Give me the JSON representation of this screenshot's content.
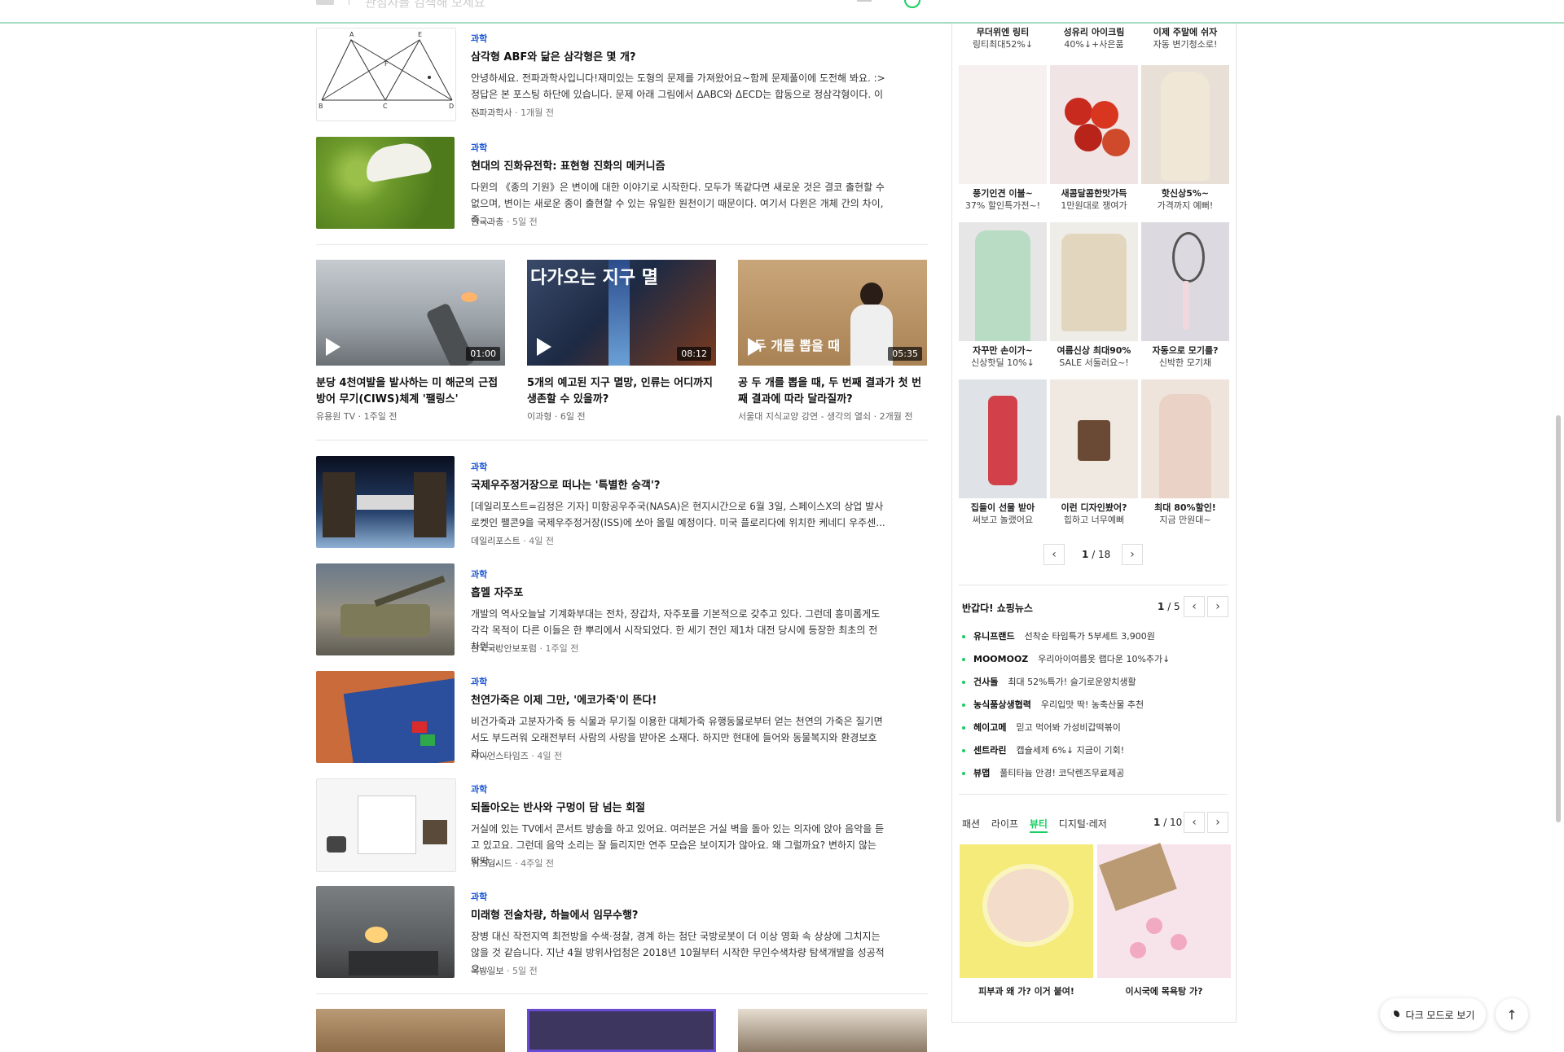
{
  "header": {
    "search_hint": "관심사를 검색해 보세요"
  },
  "articles_top": [
    {
      "category": "과학",
      "title": "삼각형 ABF와 닮은 삼각형은 몇 개?",
      "desc": "안녕하세요. 전파과학사입니다!재미있는 도형의 문제를 가져왔어요~함께 문제풀이에 도전해 봐요. :> 정답은 본 포스팅 하단에 있습니다. 문제 아래 그림에서 ΔABC와 ΔECD는 합동으로 정삼각형이다. 이 ...",
      "source": "전파과학사",
      "time": "1개월 전"
    },
    {
      "category": "과학",
      "title": "현대의 진화유전학: 표현형 진화의 메커니즘",
      "desc": "다윈의 《종의 기원》은 변이에 대한 이야기로 시작한다. 모두가 똑같다면 새로운 것은 결코 출현할 수 없으며, 변이는 새로운 종이 출현할 수 있는 유일한 원천이기 때문이다. 여기서 다윈은 개체 간의 차이, 즉...",
      "source": "한국과총",
      "time": "5일 전"
    }
  ],
  "videos": [
    {
      "duration": "01:00",
      "title": "분당 4천여발을 발사하는 미 해군의 근접방어 무기(CIWS)체계 '팰링스'",
      "source": "유용원 TV",
      "time": "1주일 전"
    },
    {
      "duration": "08:12",
      "title": "5개의 예고된 지구 멸망, 인류는 어디까지 생존할 수 있을까?",
      "source": "이과형",
      "time": "6일 전",
      "overlay": "다가오는 지구 멸"
    },
    {
      "duration": "05:35",
      "title": "공 두 개를 뽑을 때, 두 번째 결과가 첫 번째 결과에 따라 달라질까?",
      "source": "서울대 지식교양 강연 - 생각의 열쇠",
      "time": "2개월 전",
      "overlay": "두 개를 뽑을 때"
    }
  ],
  "articles_bottom": [
    {
      "category": "과학",
      "title": "국제우주정거장으로 떠나는 '특별한 승객'?",
      "desc": "[데일리포스트=김정은 기자] 미항공우주국(NASA)은 현지시간으로 6월 3일, 스페이스X의 상업 발사 로켓인 팰콘9을 국제우주정거장(ISS)에 쏘아 올릴 예정이다. 미국 플로리다에 위치한 케네디 우주센...",
      "source": "데일리포스트",
      "time": "4일 전"
    },
    {
      "category": "과학",
      "title": "흡멜 자주포",
      "desc": "개발의 역사오늘날 기계화부대는 전차, 장갑차, 자주포를 기본적으로 갖추고 있다. 그런데 흥미롭게도 각각 목적이 다른 이들은 한 뿌리에서 시작되었다. 한 세기 전인 제1차 대전 당시에 등장한 최초의 전차인...",
      "source": "한국국방안보포럼",
      "time": "1주일 전"
    },
    {
      "category": "과학",
      "title": "천연가죽은 이제 그만, '에코가죽'이 뜬다!",
      "desc": "비건가죽과 고분자가죽 등 식물과 무기질 이용한 대체가죽 유행동물로부터 얻는 천연의 가죽은 질기면서도 부드러워 오래전부터 사람의 사랑을 받아온 소재다. 하지만 현대에 들어와 동물복지와 환경보호라...",
      "source": "사이언스타임즈",
      "time": "4일 전"
    },
    {
      "category": "과학",
      "title": "되돌아오는 반사와 구멍이 담 넘는 회절",
      "desc": "거실에 있는 TV에서 콘서트 방송을 하고 있어요. 여러분은 거실 벽을 돌아 있는 의자에 앉아 음악을 듣고 있고요. 그런데 음악 소리는 잘 들리지만 연주 모습은 보이지가 않아요. 왜 그럴까요? 변하지 않는 딱딱...",
      "source": "위즈덤시드",
      "time": "4주일 전"
    },
    {
      "category": "과학",
      "title": "미래형 전술차량, 하늘에서 임무수행?",
      "desc": "장병 대신 작전지역 최전방을 수색·정찰, 경계 하는 첨단 국방로봇이 더 이상 영화 속 상상에 그치지는 않을 것 같습니다. 지난 4월 방위사업청은 2018년 10월부터 시작한 무인수색차량 탐색개발을 성공적으...",
      "source": "국방일보",
      "time": "5일 전"
    }
  ],
  "products_top_row": [
    {
      "name": "무더위엔 링티",
      "desc": "링티최대52%↓"
    },
    {
      "name": "성유리 아이크림",
      "desc": "40%↓+사은품"
    },
    {
      "name": "이제 주말에 쉬자",
      "desc": "자동 변기청소로!"
    }
  ],
  "products": [
    {
      "name": "풍기인견 이불~",
      "desc": "37% 할인특가전~!"
    },
    {
      "name": "새콤달콤한맛가득",
      "desc": "1만원대로 쟁여가"
    },
    {
      "name": "핫신상5%~",
      "desc": "가격까지 예뻐!"
    },
    {
      "name": "자꾸만 손이가~",
      "desc": "신상핫딜 10%↓"
    },
    {
      "name": "여름신상 최대90%",
      "desc": "SALE 서둘러요~!"
    },
    {
      "name": "자동으로 모기를?",
      "desc": "신박한 모기채"
    },
    {
      "name": "집들이 선물 받아",
      "desc": "써보고 놀랬어요"
    },
    {
      "name": "이런 디자인봤어?",
      "desc": "힙하고 너무예뻐"
    },
    {
      "name": "최대 80%할인!",
      "desc": "지금 만원대~"
    }
  ],
  "product_pager": {
    "current": "1",
    "total": "/ 18",
    "prev": "‹",
    "next": "›"
  },
  "shopping_news": {
    "title": "반갑다! 쇼핑뉴스",
    "current": "1",
    "total": "/ 5",
    "items": [
      {
        "brand": "유니프랜드",
        "text": "선착순 타임특가 5부세트 3,900원"
      },
      {
        "brand": "MOOMOOZ",
        "text": "우리아이여름옷 랩다운 10%추가↓"
      },
      {
        "brand": "건사돌",
        "text": "최대 52%특가! 슬기로운양치생활"
      },
      {
        "brand": "농식품상생협력",
        "text": "우리입맛 딱! 농축산물 추천"
      },
      {
        "brand": "헤이고메",
        "text": "믿고 먹어봐 가성비갑떡볶이"
      },
      {
        "brand": "센트라린",
        "text": "캡슐세제 6%↓ 지금이 기회!"
      },
      {
        "brand": "뷰맵",
        "text": "풀티타늄 안경! 코닥렌즈무료제공"
      }
    ]
  },
  "category_tabs": {
    "tabs": [
      "패션",
      "라이프",
      "뷰티",
      "디지털·레저"
    ],
    "active": "뷰티",
    "current": "1",
    "total": "/ 10"
  },
  "beauty_items": [
    {
      "caption": "피부과 왜 가? 이거 붙여!"
    },
    {
      "caption": "이시국에 목욕탕 가?"
    }
  ],
  "floating": {
    "dark_mode": "다크 모드로 보기",
    "top": "↑"
  },
  "colors": {
    "accent": "#19ce60",
    "category": "#1a56d6"
  }
}
